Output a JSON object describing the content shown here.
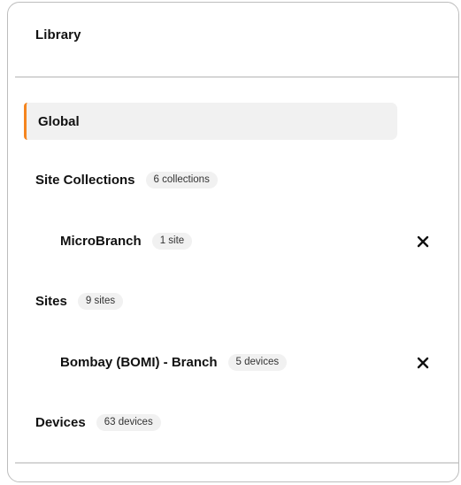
{
  "panel": {
    "title": "Library"
  },
  "global": {
    "label": "Global",
    "accent_color": "#f5851f"
  },
  "site_collections": {
    "label": "Site Collections",
    "count": "6 collections",
    "items": [
      {
        "label": "MicroBranch",
        "count": "1 site",
        "remove_icon": "close-icon"
      }
    ]
  },
  "sites": {
    "label": "Sites",
    "count": "9 sites",
    "items": [
      {
        "label": "Bombay (BOMI) - Branch",
        "count": "5 devices",
        "remove_icon": "close-icon"
      }
    ]
  },
  "devices": {
    "label": "Devices",
    "count": "63 devices"
  }
}
